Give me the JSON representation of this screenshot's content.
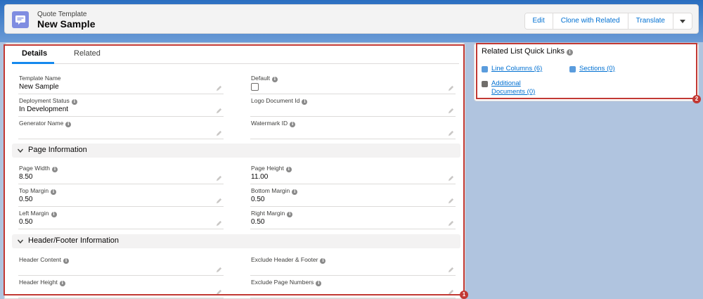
{
  "header": {
    "object_type": "Quote Template",
    "record_name": "New Sample",
    "icon": "quote-template-icon",
    "buttons": {
      "edit": "Edit",
      "clone": "Clone with Related",
      "translate": "Translate",
      "more": "more-actions-icon"
    }
  },
  "tabs": [
    {
      "label": "Details",
      "active": true
    },
    {
      "label": "Related",
      "active": false
    }
  ],
  "fields": {
    "template_name": {
      "label": "Template Name",
      "value": "New Sample"
    },
    "default": {
      "label": "Default",
      "checked": false
    },
    "deployment_status": {
      "label": "Deployment Status",
      "value": "In Development"
    },
    "logo_document_id": {
      "label": "Logo Document Id",
      "value": ""
    },
    "generator_name": {
      "label": "Generator Name",
      "value": ""
    },
    "watermark_id": {
      "label": "Watermark ID",
      "value": ""
    }
  },
  "page_information": {
    "title": "Page Information",
    "page_width": {
      "label": "Page Width",
      "value": "8.50"
    },
    "page_height": {
      "label": "Page Height",
      "value": "11.00"
    },
    "top_margin": {
      "label": "Top Margin",
      "value": "0.50"
    },
    "bottom_margin": {
      "label": "Bottom Margin",
      "value": "0.50"
    },
    "left_margin": {
      "label": "Left Margin",
      "value": "0.50"
    },
    "right_margin": {
      "label": "Right Margin",
      "value": "0.50"
    }
  },
  "header_footer": {
    "title": "Header/Footer Information",
    "header_content": {
      "label": "Header Content",
      "value": ""
    },
    "exclude_header_footer": {
      "label": "Exclude Header & Footer",
      "value": ""
    },
    "header_height": {
      "label": "Header Height",
      "value": ""
    },
    "exclude_page_numbers": {
      "label": "Exclude Page Numbers",
      "value": ""
    }
  },
  "quick_links": {
    "title": "Related List Quick Links",
    "items": [
      {
        "label": "Line Columns (6)",
        "icon": "line-columns-icon",
        "color": "#5a9cdd"
      },
      {
        "label": "Sections (0)",
        "icon": "sections-icon",
        "color": "#5a9cdd"
      },
      {
        "label_line1": "Additional",
        "label_line2": "Documents (0)",
        "icon": "attachment-icon",
        "color": "#706e6b"
      }
    ]
  },
  "annotations": {
    "badge_1": "1",
    "badge_2": "2"
  },
  "colors": {
    "link": "#0070d2",
    "highlight": "#c23934",
    "tab_active": "#1589ee",
    "object_icon": "#7f8de1"
  }
}
